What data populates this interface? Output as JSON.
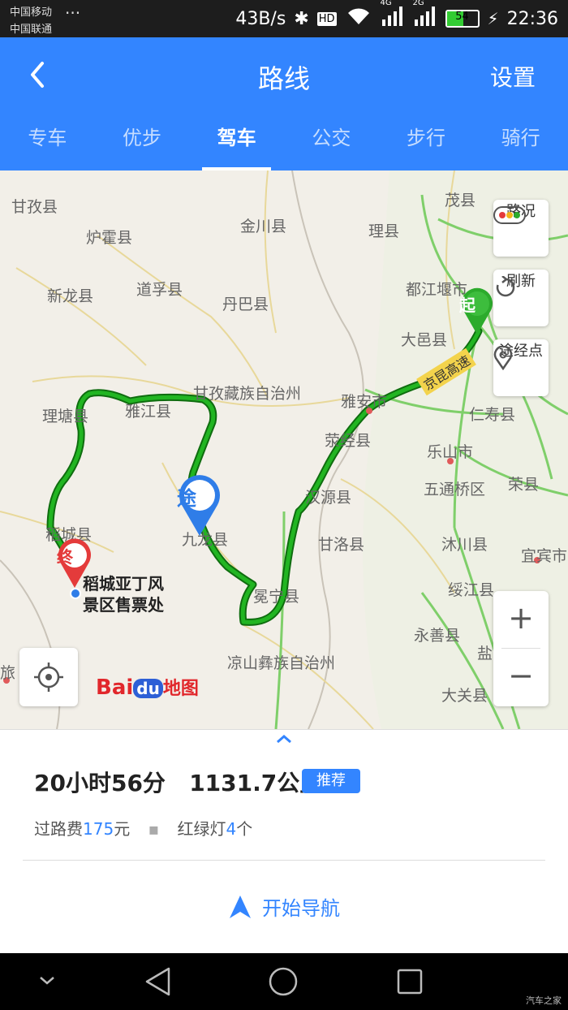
{
  "status": {
    "carrier1": "中国移动",
    "carrier2": "中国联通",
    "more": "···",
    "speed": "43B/s",
    "hd": "HD",
    "net1": "4G",
    "net2": "2G",
    "battery": "54",
    "time": "22:36"
  },
  "header": {
    "title": "路线",
    "settings": "设置",
    "back_icon": "back-arrow-icon"
  },
  "tabs": [
    {
      "label": "专车",
      "active": false
    },
    {
      "label": "优步",
      "active": false
    },
    {
      "label": "驾车",
      "active": true
    },
    {
      "label": "公交",
      "active": false
    },
    {
      "label": "步行",
      "active": false
    },
    {
      "label": "骑行",
      "active": false
    }
  ],
  "map": {
    "places": [
      "甘孜县",
      "金川县",
      "茂县",
      "炉霍县",
      "理县",
      "新龙县",
      "道孚县",
      "丹巴县",
      "都江堰市",
      "大邑县",
      "甘孜藏族自治州",
      "雅安市",
      "理塘县",
      "雅江县",
      "荥经县",
      "仁寿县",
      "乐山市",
      "五通桥区",
      "荣县",
      "汉源县",
      "稻城县",
      "九龙县",
      "甘洛县",
      "沐川县",
      "宜宾市",
      "冕宁县",
      "绥江县",
      "永善县",
      "凉山彝族自治州",
      "大关县",
      "盐",
      "旅"
    ],
    "highway_label": "京昆高速",
    "start_marker": "起",
    "via_marker": "途",
    "end_marker": "终",
    "destination_line1": "稻城亚丁风",
    "destination_line2": "景区售票处",
    "controls": {
      "traffic": "路况",
      "refresh": "刷新",
      "waypoint": "途经点",
      "zoom_in": "+",
      "zoom_out": "−"
    },
    "logo": {
      "bai": "Bai",
      "du": "du",
      "map": "地图"
    },
    "route_color": "#1a9a1a",
    "route_border": "#0f6d0f"
  },
  "route": {
    "duration": "20小时56分",
    "distance": "1131.7公里",
    "badge": "推荐",
    "toll_label": "过路费",
    "toll_value": "175",
    "toll_unit": "元",
    "lights_label": "红绿灯",
    "lights_value": "4",
    "lights_unit": "个",
    "start_nav": "开始导航"
  },
  "watermark": "汽车之家"
}
